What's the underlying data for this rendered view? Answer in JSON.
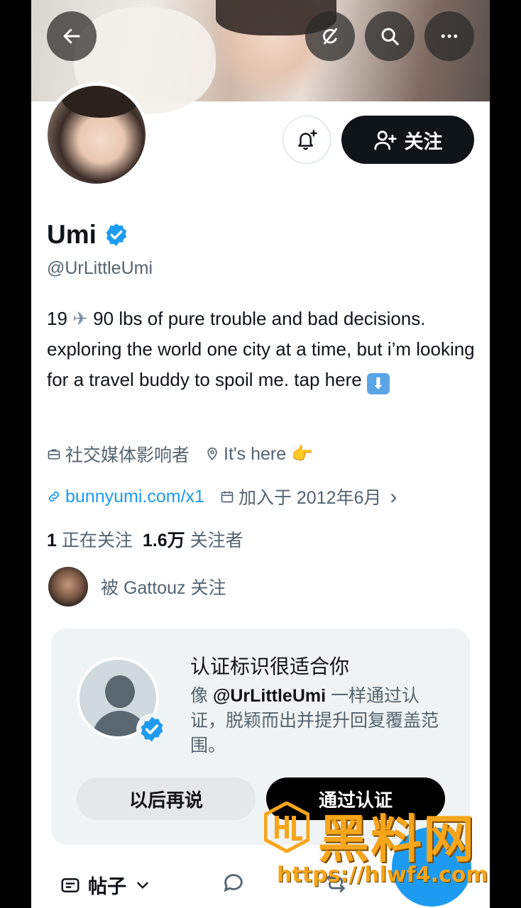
{
  "profile": {
    "name": "Umi",
    "handle": "@UrLittleUmi",
    "bio_parts": [
      "19 ",
      "✈",
      " 90 lbs of pure trouble and bad decisions. exploring the world one city at a time, but i’m looking for a travel buddy to spoil me. tap here "
    ],
    "bio_emoji": "⬇",
    "category": "社交媒体影响者",
    "location": "It's here 👉",
    "website": "bunnyumi.com/x1",
    "joined": "加入于 2012年6月",
    "joined_chevron": "›"
  },
  "actions": {
    "follow_label": "关注"
  },
  "stats": {
    "following_count": "1",
    "following_label": "正在关注",
    "followers_count": "1.6万",
    "followers_label": "关注者"
  },
  "followed_by": "被 Gattouz 关注",
  "verify_card": {
    "title": "认证标识很适合你",
    "desc_prefix": "像 ",
    "desc_handle": "@UrLittleUmi",
    "desc_suffix": " 一样通过认证，脱颖而出并提升回复覆盖范围。",
    "later_label": "以后再说",
    "verify_label": "通过认证"
  },
  "tabs": {
    "posts_label": "帖子"
  },
  "watermark": {
    "brand": "黑料网",
    "url": "https://hlwf4.com"
  },
  "colors": {
    "accent": "#1d9bf0",
    "text_primary": "#0f1419",
    "text_secondary": "#536471",
    "watermark": "#f7a51a"
  }
}
